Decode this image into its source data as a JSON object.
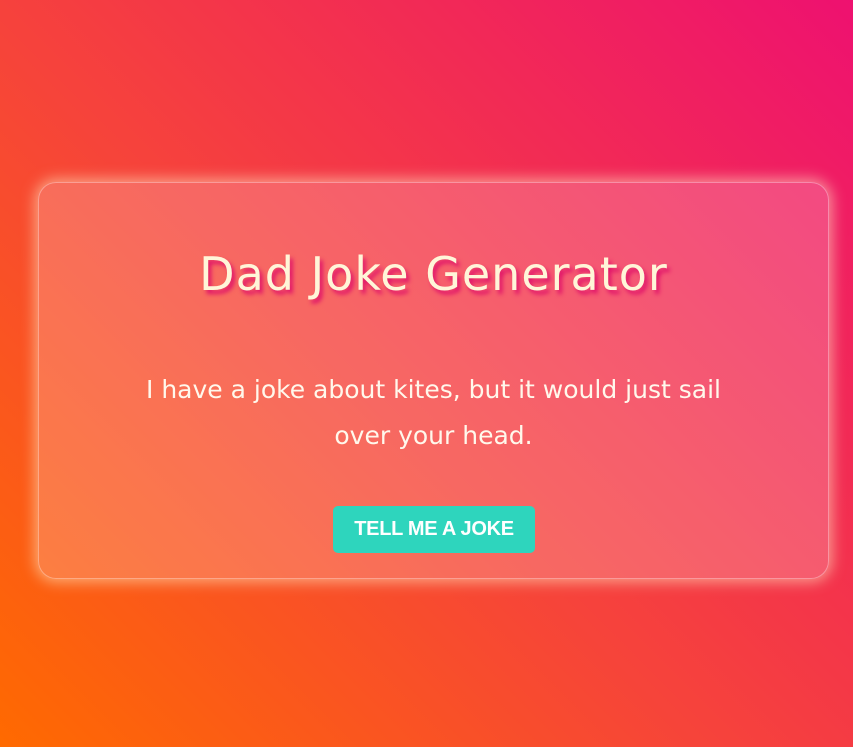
{
  "app": {
    "title": "Dad Joke Generator"
  },
  "joke": {
    "text": "I have a joke about kites, but it would just sail over your head."
  },
  "actions": {
    "tell_joke_label": "TELL ME A JOKE"
  },
  "colors": {
    "background_gradient": [
      "#ff6a00",
      "#f6433b",
      "#ee1170"
    ],
    "title_text": "#fff6d8",
    "title_shadow": "#e0126a",
    "button_bg": "#2ed5bd",
    "button_text": "#ffffff"
  }
}
